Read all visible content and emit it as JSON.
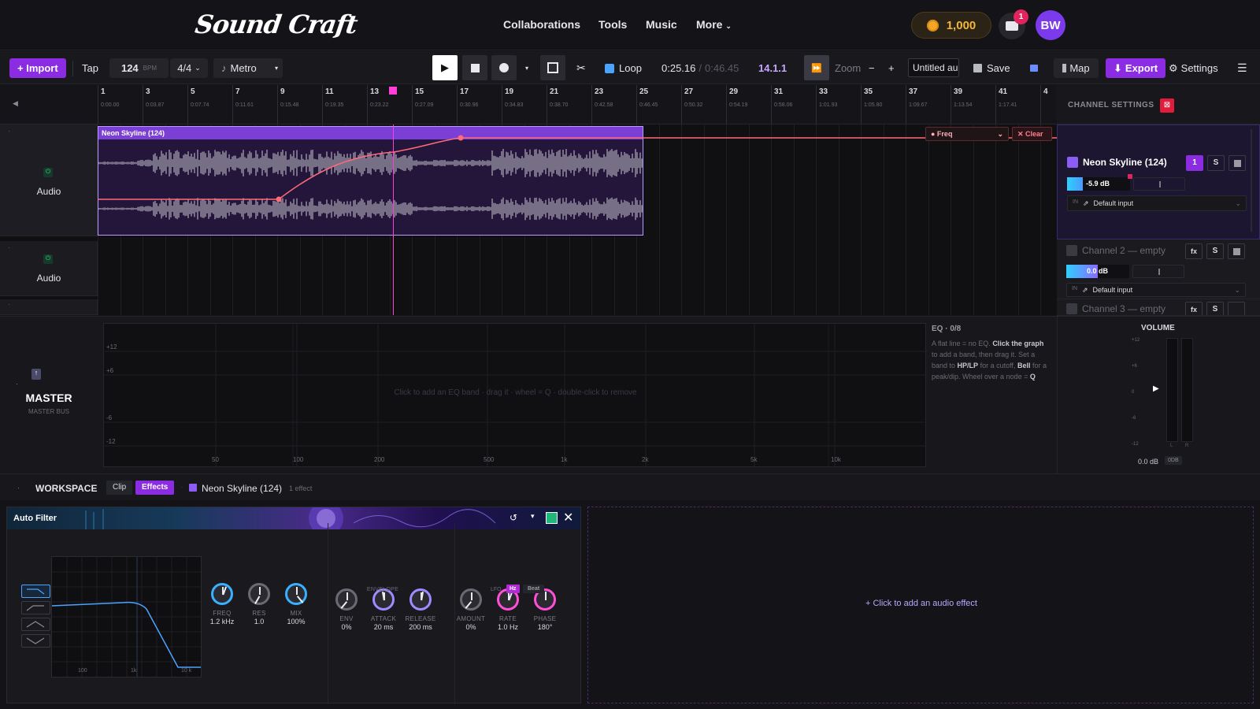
{
  "header": {
    "logo": "Sound Craft",
    "nav": [
      "Collaborations",
      "Tools",
      "Music",
      "More"
    ],
    "coins": "1,000",
    "mail_count": "1",
    "avatar": "BW"
  },
  "toolbar": {
    "import": "+ Import",
    "tap": "Tap",
    "bpm": "124",
    "bpm_unit": "BPM",
    "time_sig": "4/4",
    "metro": "Metro",
    "loop": "Loop",
    "time_current": "0:25.16",
    "time_sep": "/",
    "time_total": "0:46.45",
    "position": "14.1.1",
    "zoom": "Zoom",
    "zoom_minus": "−",
    "zoom_plus": "+",
    "project_name": "Untitled au",
    "save": "Save",
    "map": "Map",
    "export": "Export",
    "settings": "Settings"
  },
  "ruler": {
    "bars": [
      {
        "n": "1",
        "t": "0:00.00"
      },
      {
        "n": "3",
        "t": "0:03.87"
      },
      {
        "n": "5",
        "t": "0:07.74"
      },
      {
        "n": "7",
        "t": "0:11.61"
      },
      {
        "n": "9",
        "t": "0:15.48"
      },
      {
        "n": "11",
        "t": "0:19.35"
      },
      {
        "n": "13",
        "t": "0:23.22"
      },
      {
        "n": "15",
        "t": "0:27.09"
      },
      {
        "n": "17",
        "t": "0:30.96"
      },
      {
        "n": "19",
        "t": "0:34.83"
      },
      {
        "n": "21",
        "t": "0:38.70"
      },
      {
        "n": "23",
        "t": "0:42.58"
      },
      {
        "n": "25",
        "t": "0:46.45"
      },
      {
        "n": "27",
        "t": "0:50.32"
      },
      {
        "n": "29",
        "t": "0:54.19"
      },
      {
        "n": "31",
        "t": "0:58.06"
      },
      {
        "n": "33",
        "t": "1:01.93"
      },
      {
        "n": "35",
        "t": "1:05.80"
      },
      {
        "n": "37",
        "t": "1:09.67"
      },
      {
        "n": "39",
        "t": "1:13.54"
      },
      {
        "n": "41",
        "t": "1:17.41"
      },
      {
        "n": "4",
        "t": ""
      }
    ]
  },
  "tracks": [
    {
      "label": "Audio"
    },
    {
      "label": "Audio"
    }
  ],
  "clip": {
    "title": "Neon Skyline (124)"
  },
  "automation": {
    "param": "● Freq",
    "clear": "✕ Clear"
  },
  "channel_settings": {
    "title": "CHANNEL SETTINGS",
    "channels": [
      {
        "name": "Neon Skyline (124)",
        "db": "-5.9 dB",
        "input_tag": "IN",
        "input": "Default input",
        "btn1": "1",
        "btn2": "S"
      },
      {
        "name": "Channel 2 — empty",
        "db": "0.0 dB",
        "input_tag": "IN",
        "input": "Default input",
        "btn1": "fx",
        "btn2": "S"
      },
      {
        "name": "Channel 3 — empty",
        "btn1": "fx",
        "btn2": "S"
      }
    ]
  },
  "master": {
    "title": "MASTER",
    "subtitle": "MASTER BUS",
    "eq": {
      "y_labels": [
        "+12",
        "+6",
        "-6",
        "-12"
      ],
      "x_labels": [
        "50",
        "100",
        "200",
        "500",
        "1k",
        "2k",
        "5k",
        "10k"
      ],
      "hint": "Click to add an EQ band · drag it · wheel = Q · double-click to remove"
    },
    "eq_info": {
      "title": "EQ · 0/8",
      "p1": "A flat line = no EQ.",
      "b1": "Click the graph",
      "p2": "to add a band, then drag it. Set a band to",
      "b2": "HP/LP",
      "p3": "for a cutoff,",
      "b3": "Bell",
      "p4": "for a peak/dip. Wheel over a node =",
      "b4": "Q"
    },
    "volume": {
      "title": "VOLUME",
      "scale": [
        "+12",
        "+6",
        "0",
        "-6",
        "-12"
      ],
      "value": "0.0 dB",
      "db_btn": "0DB",
      "lr": [
        "L",
        "R"
      ]
    }
  },
  "workspace": {
    "title": "WORKSPACE",
    "tabs": [
      "Clip",
      "Effects"
    ],
    "clip_name": "Neon Skyline (124)",
    "effect_count": "1 effect"
  },
  "effect": {
    "title": "Auto Filter",
    "graph_labels": [
      "100",
      "1k",
      "10 k"
    ],
    "knobs": [
      {
        "label": "FREQ",
        "value": "1.2 kHz"
      },
      {
        "label": "RES",
        "value": "1.0"
      },
      {
        "label": "MIX",
        "value": "100%"
      }
    ],
    "envelope": {
      "title": "ENVELOPE",
      "knobs": [
        {
          "label": "ENV",
          "value": "0%"
        },
        {
          "label": "ATTACK",
          "value": "20 ms"
        },
        {
          "label": "RELEASE",
          "value": "200 ms"
        }
      ]
    },
    "lfo": {
      "title": "LFO",
      "modes": [
        "Hz",
        "Beat"
      ],
      "knobs": [
        {
          "label": "AMOUNT",
          "value": "0%"
        },
        {
          "label": "RATE",
          "value": "1.0 Hz"
        },
        {
          "label": "PHASE",
          "value": "180°"
        }
      ]
    }
  },
  "add_effect": "+ Click to add an audio effect"
}
